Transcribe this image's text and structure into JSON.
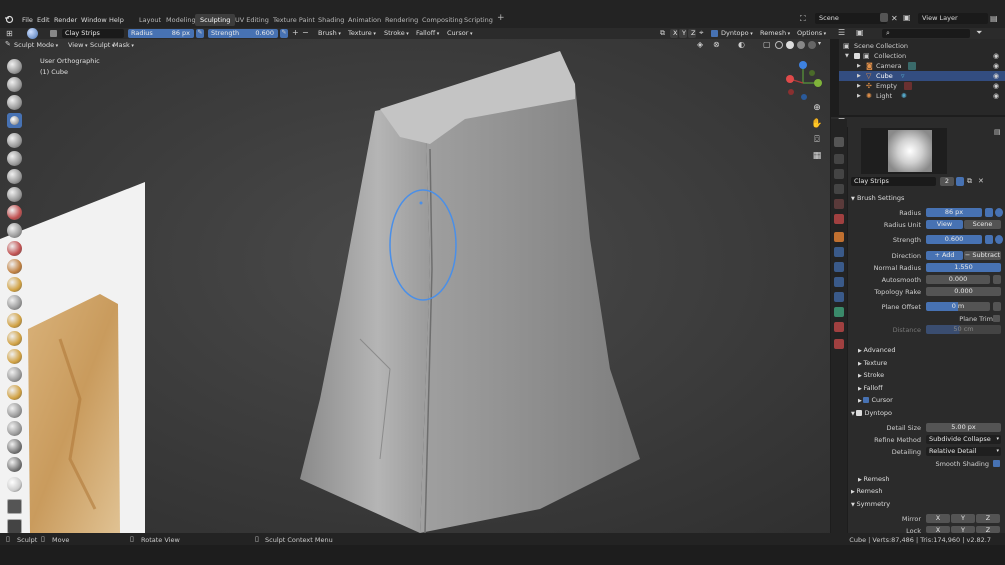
{
  "menu": [
    "File",
    "Edit",
    "Render",
    "Window",
    "Help"
  ],
  "workspaces": [
    "Layout",
    "Modeling",
    "Sculpting",
    "UV Editing",
    "Texture Paint",
    "Shading",
    "Animation",
    "Rendering",
    "Compositing",
    "Scripting"
  ],
  "active_workspace": "Sculpting",
  "scene": "Scene",
  "view_layer": "View Layer",
  "toolbar": {
    "brush_name": "Clay Strips",
    "radius_label": "Radius",
    "radius_value": "86 px",
    "strength_label": "Strength",
    "strength_value": "0.600",
    "brush_menu": "Brush",
    "texture_menu": "Texture",
    "stroke_menu": "Stroke",
    "falloff_menu": "Falloff",
    "cursor_menu": "Cursor",
    "axis_x": "X",
    "axis_y": "Y",
    "axis_z": "Z",
    "dyntopo": "Dyntopo",
    "remesh": "Remesh",
    "options": "Options"
  },
  "header": {
    "mode": "Sculpt Mode",
    "view": "View",
    "sculpt": "Sculpt",
    "mask": "Mask"
  },
  "viewport": {
    "view_name": "User Orthographic",
    "object_name": "(1) Cube"
  },
  "outliner": {
    "root": "Scene Collection",
    "collection": "Collection",
    "items": [
      "Camera",
      "Cube",
      "Empty",
      "Light"
    ]
  },
  "properties": {
    "brush_name": "Clay Strips",
    "brush_users": "2",
    "brush_settings": "Brush Settings",
    "radius_label": "Radius",
    "radius_value": "86 px",
    "radius_unit_label": "Radius Unit",
    "unit_view": "View",
    "unit_scene": "Scene",
    "strength_label": "Strength",
    "strength_value": "0.600",
    "direction_label": "Direction",
    "dir_add": "Add",
    "dir_subtract": "Subtract",
    "normal_radius_label": "Normal Radius",
    "normal_radius_value": "1.550",
    "autosmooth_label": "Autosmooth",
    "autosmooth_value": "0.000",
    "topology_rake_label": "Topology Rake",
    "topology_rake_value": "0.000",
    "plane_offset_label": "Plane Offset",
    "plane_offset_value": "0 m",
    "plane_trim_label": "Plane Trim",
    "distance_label": "Distance",
    "distance_value": "50 cm",
    "advanced": "Advanced",
    "texture": "Texture",
    "stroke": "Stroke",
    "falloff": "Falloff",
    "cursor": "Cursor",
    "dyntopo": "Dyntopo",
    "detail_size_label": "Detail Size",
    "detail_size_value": "5.00 px",
    "refine_method_label": "Refine Method",
    "refine_method_value": "Subdivide Collapse",
    "detailing_label": "Detailing",
    "detailing_value": "Relative Detail",
    "smooth_shading_label": "Smooth Shading",
    "remesh_sub": "Remesh",
    "remesh": "Remesh",
    "symmetry": "Symmetry",
    "mirror_label": "Mirror",
    "lock_label": "Lock",
    "x": "X",
    "y": "Y",
    "z": "Z"
  },
  "status": {
    "sculpt": "Sculpt",
    "move": "Move",
    "rotate_view": "Rotate View",
    "context_menu": "Sculpt Context Menu",
    "stats": "Cube | Verts:87,486 | Tris:174,960 | v2.82.7"
  },
  "colors": {
    "accent": "#4772b3",
    "selection": "#334d80",
    "viewport_bg": "#3a3a3a",
    "panel_bg": "#2b2b2b"
  }
}
